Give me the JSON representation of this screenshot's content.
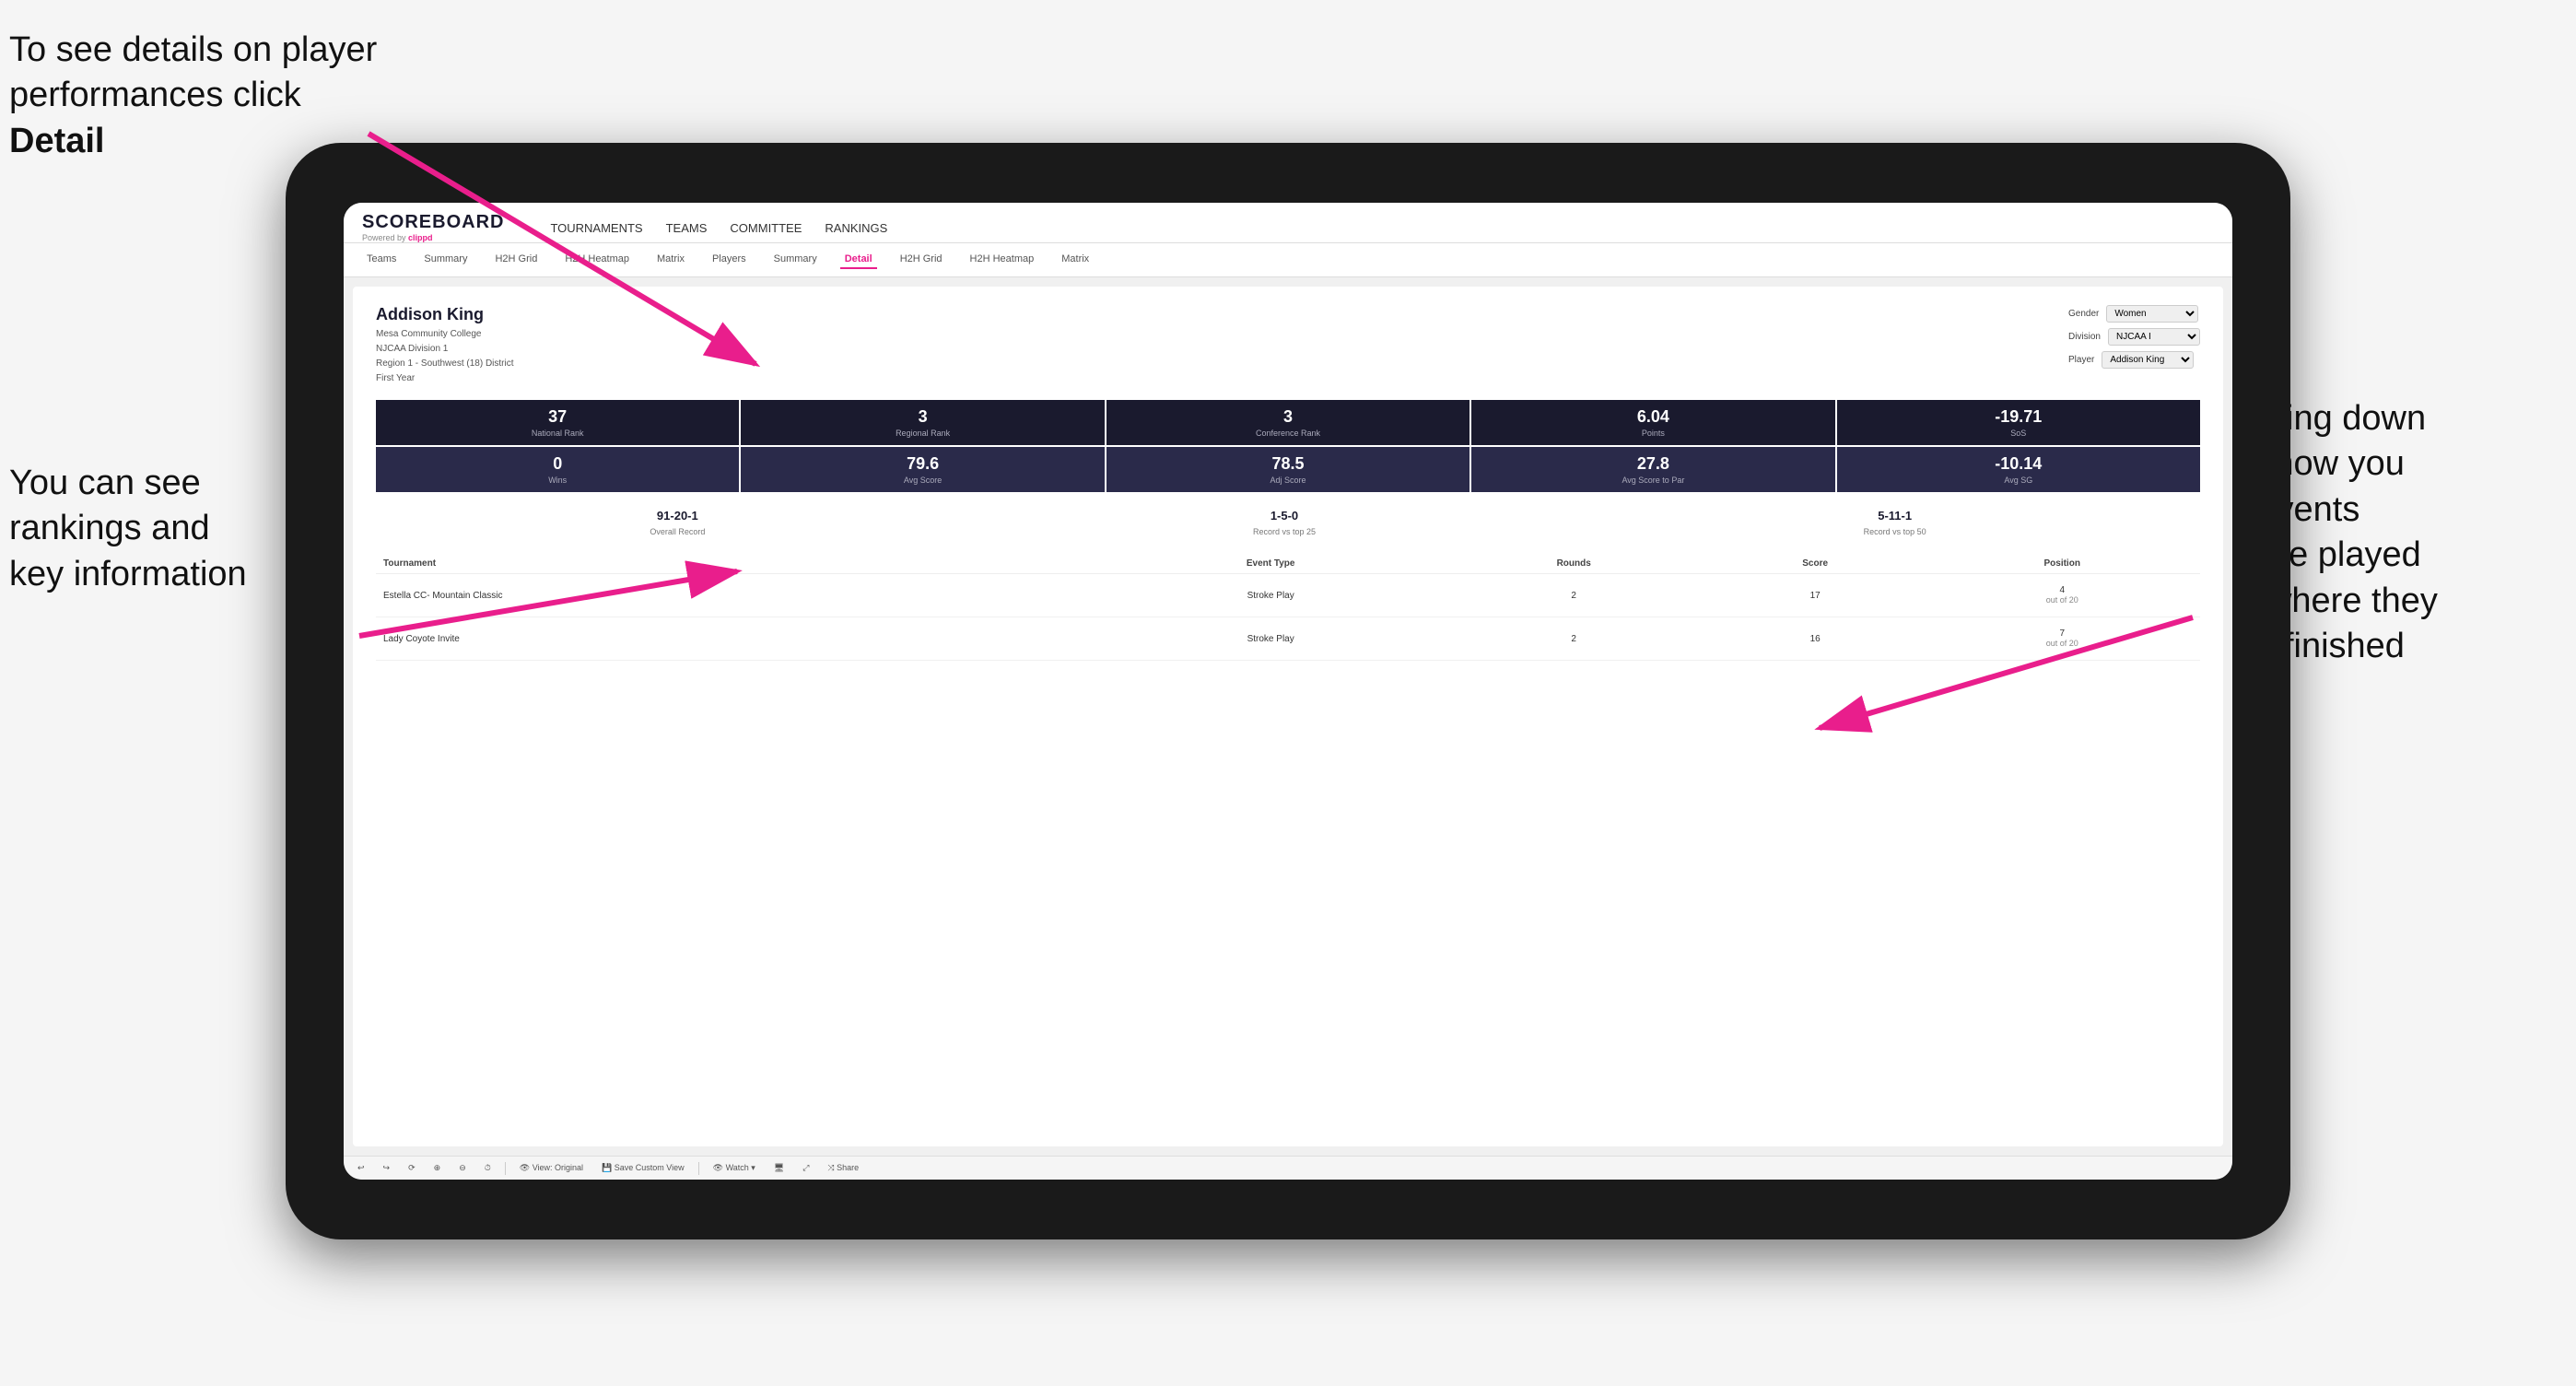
{
  "annotations": {
    "top_left": "To see details on player performances click ",
    "top_left_bold": "Detail",
    "bottom_left_line1": "You can see",
    "bottom_left_line2": "rankings and",
    "bottom_left_line3": "key information",
    "right_line1": "Scrolling down",
    "right_line2": "will show you",
    "right_line3": "the events",
    "right_line4": "they've played",
    "right_line5": "and where they",
    "right_line6": "have finished"
  },
  "nav": {
    "logo": "SCOREBOARD",
    "powered_by": "Powered by ",
    "clippd": "clippd",
    "items": [
      {
        "label": "TOURNAMENTS",
        "active": false
      },
      {
        "label": "TEAMS",
        "active": false
      },
      {
        "label": "COMMITTEE",
        "active": false
      },
      {
        "label": "RANKINGS",
        "active": false
      }
    ]
  },
  "subnav": {
    "items": [
      {
        "label": "Teams",
        "active": false
      },
      {
        "label": "Summary",
        "active": false
      },
      {
        "label": "H2H Grid",
        "active": false
      },
      {
        "label": "H2H Heatmap",
        "active": false
      },
      {
        "label": "Matrix",
        "active": false
      },
      {
        "label": "Players",
        "active": false
      },
      {
        "label": "Summary",
        "active": false
      },
      {
        "label": "Detail",
        "active": true
      },
      {
        "label": "H2H Grid",
        "active": false
      },
      {
        "label": "H2H Heatmap",
        "active": false
      },
      {
        "label": "Matrix",
        "active": false
      }
    ]
  },
  "player": {
    "name": "Addison King",
    "school": "Mesa Community College",
    "division": "NJCAA Division 1",
    "region": "Region 1 - Southwest (18) District",
    "year": "First Year"
  },
  "controls": {
    "gender_label": "Gender",
    "gender_value": "Women",
    "division_label": "Division",
    "division_value": "NJCAA I",
    "player_label": "Player",
    "player_value": "Addison King"
  },
  "stats_row1": [
    {
      "value": "37",
      "label": "National Rank"
    },
    {
      "value": "3",
      "label": "Regional Rank"
    },
    {
      "value": "3",
      "label": "Conference Rank"
    },
    {
      "value": "6.04",
      "label": "Points"
    },
    {
      "value": "-19.71",
      "label": "SoS"
    }
  ],
  "stats_row2": [
    {
      "value": "0",
      "label": "Wins"
    },
    {
      "value": "79.6",
      "label": "Avg Score"
    },
    {
      "value": "78.5",
      "label": "Adj Score"
    },
    {
      "value": "27.8",
      "label": "Avg Score to Par"
    },
    {
      "value": "-10.14",
      "label": "Avg SG"
    }
  ],
  "records": [
    {
      "value": "91-20-1",
      "label": "Overall Record"
    },
    {
      "value": "1-5-0",
      "label": "Record vs top 25"
    },
    {
      "value": "5-11-1",
      "label": "Record vs top 50"
    }
  ],
  "table": {
    "headers": [
      "Tournament",
      "Event Type",
      "Rounds",
      "Score",
      "Position"
    ],
    "rows": [
      {
        "tournament": "Estella CC- Mountain Classic",
        "event_type": "Stroke Play",
        "rounds": "2",
        "score": "17",
        "position": "4 out of 20"
      },
      {
        "tournament": "Lady Coyote Invite",
        "event_type": "Stroke Play",
        "rounds": "2",
        "score": "16",
        "position": "7 out of 20"
      }
    ]
  },
  "toolbar": {
    "buttons": [
      {
        "label": "↩",
        "name": "undo"
      },
      {
        "label": "↪",
        "name": "redo"
      },
      {
        "label": "⟳",
        "name": "refresh"
      },
      {
        "label": "⊕",
        "name": "add"
      },
      {
        "label": "⊖",
        "name": "remove"
      },
      {
        "label": "⏱",
        "name": "timer"
      },
      {
        "label": "👁 View: Original",
        "name": "view"
      },
      {
        "label": "💾 Save Custom View",
        "name": "save"
      },
      {
        "label": "👁 Watch ▾",
        "name": "watch"
      },
      {
        "label": "🖥",
        "name": "screen"
      },
      {
        "label": "⤢",
        "name": "expand"
      },
      {
        "label": "Share",
        "name": "share"
      }
    ]
  }
}
